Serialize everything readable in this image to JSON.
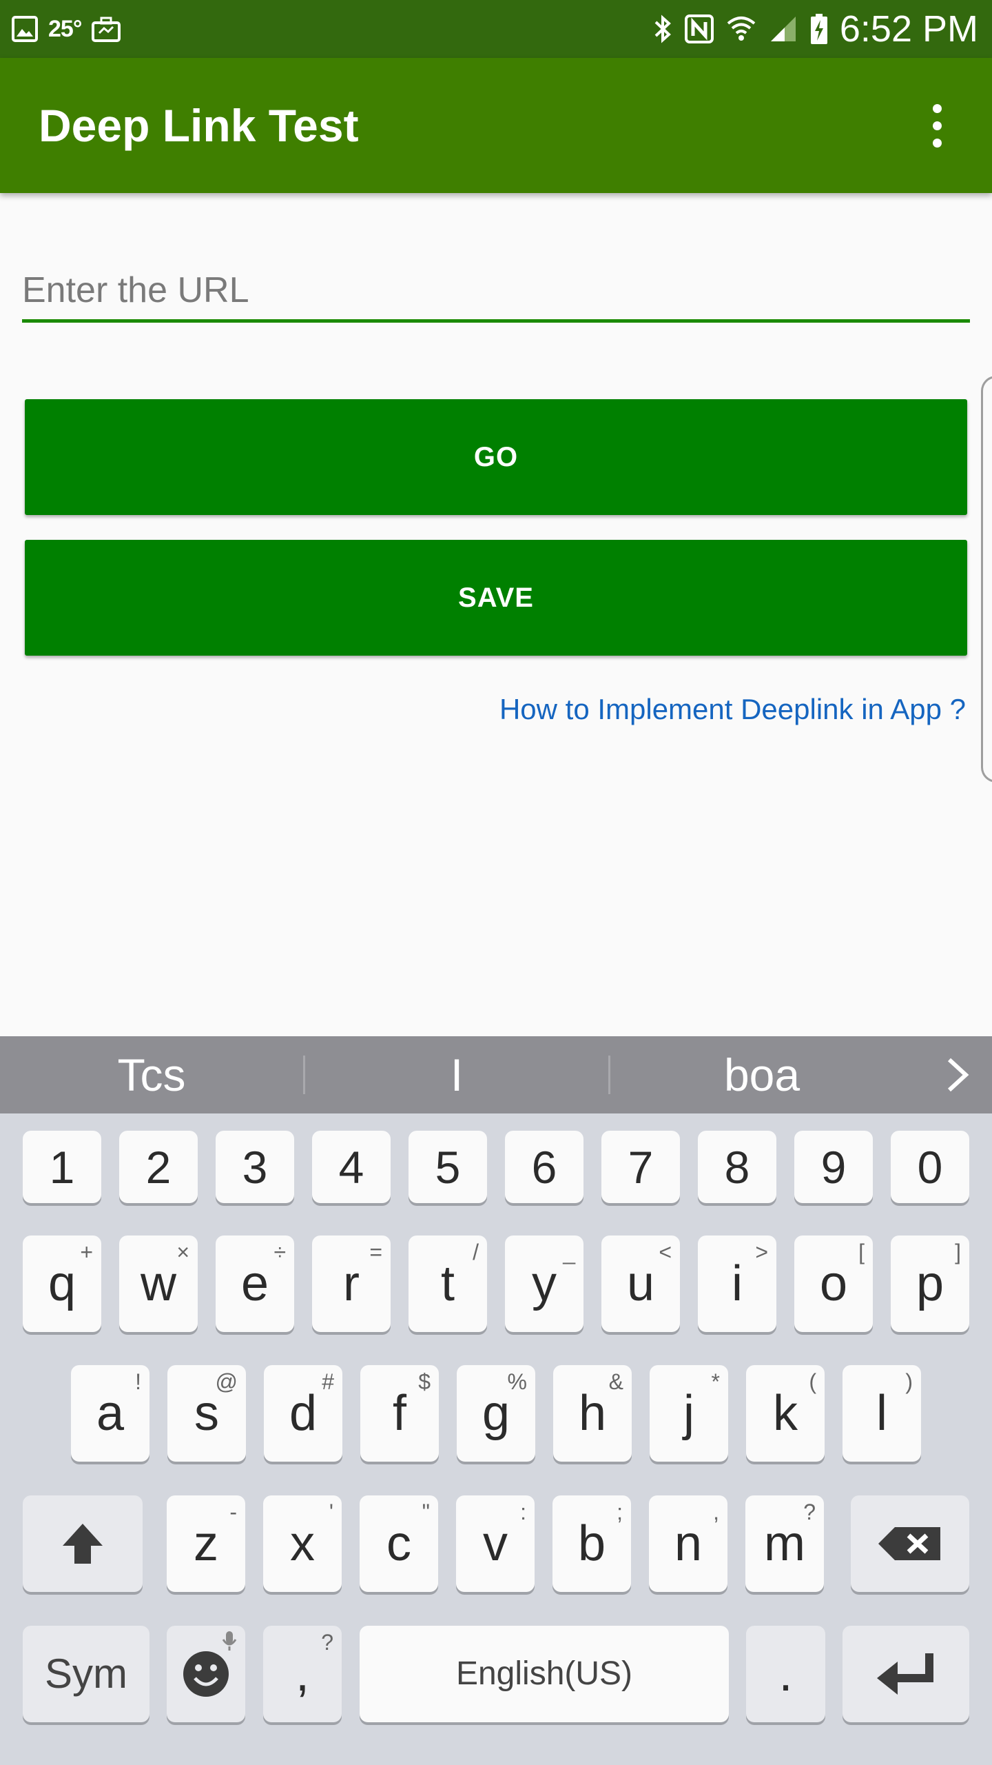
{
  "status_bar": {
    "temperature": "25°",
    "time": "6:52 PM",
    "left_icons": [
      "gallery-icon",
      "weather-icon",
      "briefcase-icon"
    ],
    "right_icons": [
      "bluetooth-icon",
      "nfc-icon",
      "wifi-icon",
      "cell-signal-icon",
      "battery-charging-icon"
    ]
  },
  "app_bar": {
    "title": "Deep Link Test",
    "menu_icon": "overflow-menu-icon",
    "color": "#3f7f00"
  },
  "form": {
    "url_placeholder": "Enter the URL",
    "url_value": "",
    "go_label": "GO",
    "save_label": "SAVE",
    "help_link": "How to Implement Deeplink in App ?",
    "accent_color": "#008000",
    "link_color": "#1565c0"
  },
  "keyboard": {
    "suggestions": [
      "Tcs",
      "I",
      "boa"
    ],
    "number_row": [
      "1",
      "2",
      "3",
      "4",
      "5",
      "6",
      "7",
      "8",
      "9",
      "0"
    ],
    "row1": [
      {
        "main": "q",
        "sub": "+"
      },
      {
        "main": "w",
        "sub": "×"
      },
      {
        "main": "e",
        "sub": "÷"
      },
      {
        "main": "r",
        "sub": "="
      },
      {
        "main": "t",
        "sub": "/"
      },
      {
        "main": "y",
        "sub": "_"
      },
      {
        "main": "u",
        "sub": "<"
      },
      {
        "main": "i",
        "sub": ">"
      },
      {
        "main": "o",
        "sub": "["
      },
      {
        "main": "p",
        "sub": "]"
      }
    ],
    "row2": [
      {
        "main": "a",
        "sub": "!"
      },
      {
        "main": "s",
        "sub": "@"
      },
      {
        "main": "d",
        "sub": "#"
      },
      {
        "main": "f",
        "sub": "$"
      },
      {
        "main": "g",
        "sub": "%"
      },
      {
        "main": "h",
        "sub": "&"
      },
      {
        "main": "j",
        "sub": "*"
      },
      {
        "main": "k",
        "sub": "("
      },
      {
        "main": "l",
        "sub": ")"
      }
    ],
    "row3": [
      {
        "main": "z",
        "sub": "-"
      },
      {
        "main": "x",
        "sub": "'"
      },
      {
        "main": "c",
        "sub": "\""
      },
      {
        "main": "v",
        "sub": ":"
      },
      {
        "main": "b",
        "sub": ";"
      },
      {
        "main": "n",
        "sub": ","
      },
      {
        "main": "m",
        "sub": "?"
      }
    ],
    "sym_label": "Sym",
    "comma": {
      "main": ",",
      "sub": "?"
    },
    "space_label": "English(US)",
    "period": "."
  }
}
